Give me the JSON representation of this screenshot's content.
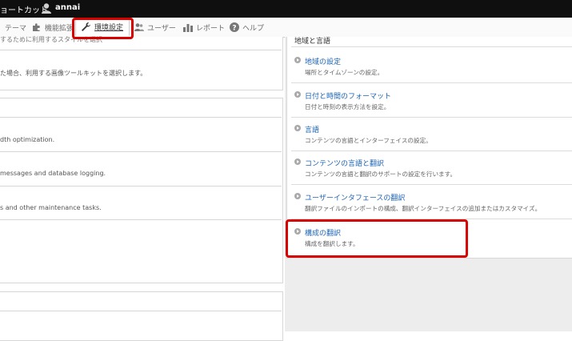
{
  "topbar": {
    "shortcut_label": "ョートカット",
    "username": "annai"
  },
  "nav": {
    "items": [
      {
        "label": "テーマ"
      },
      {
        "label": "機能拡張"
      },
      {
        "label": "環境設定"
      },
      {
        "label": "ユーザー"
      },
      {
        "label": "レポート"
      },
      {
        "label": "ヘルプ"
      }
    ]
  },
  "left": {
    "top_text_1": "するために利用するスタイルを選択",
    "top_text_2": "た場合、利用する画像ツールキットを選択します。",
    "row_1": "dth optimization.",
    "row_2": "messages and database logging.",
    "row_3": "s and other maintenance tasks."
  },
  "region": {
    "title": "地域と言語",
    "items": [
      {
        "title": "地域の設定",
        "desc": "場所とタイムゾーンの設定。"
      },
      {
        "title": "日付と時間のフォーマット",
        "desc": "日付と時刻の表示方法を設定。"
      },
      {
        "title": "言語",
        "desc": "コンテンツの言語とインターフェイスの設定。"
      },
      {
        "title": "コンテンツの言語と翻訳",
        "desc": "コンテンツの言語と翻訳のサポートの設定を行います。"
      },
      {
        "title": "ユーザーインタフェースの翻訳",
        "desc": "翻訳ファイルのインポートの構成、翻訳インターフェイスの追加またはカスタマイズ。"
      },
      {
        "title": "構成の翻訳",
        "desc": "構成を翻訳します。"
      }
    ]
  },
  "colors": {
    "highlight": "#d90000",
    "link": "#1c64b4",
    "topbar": "#0f0f0f"
  }
}
